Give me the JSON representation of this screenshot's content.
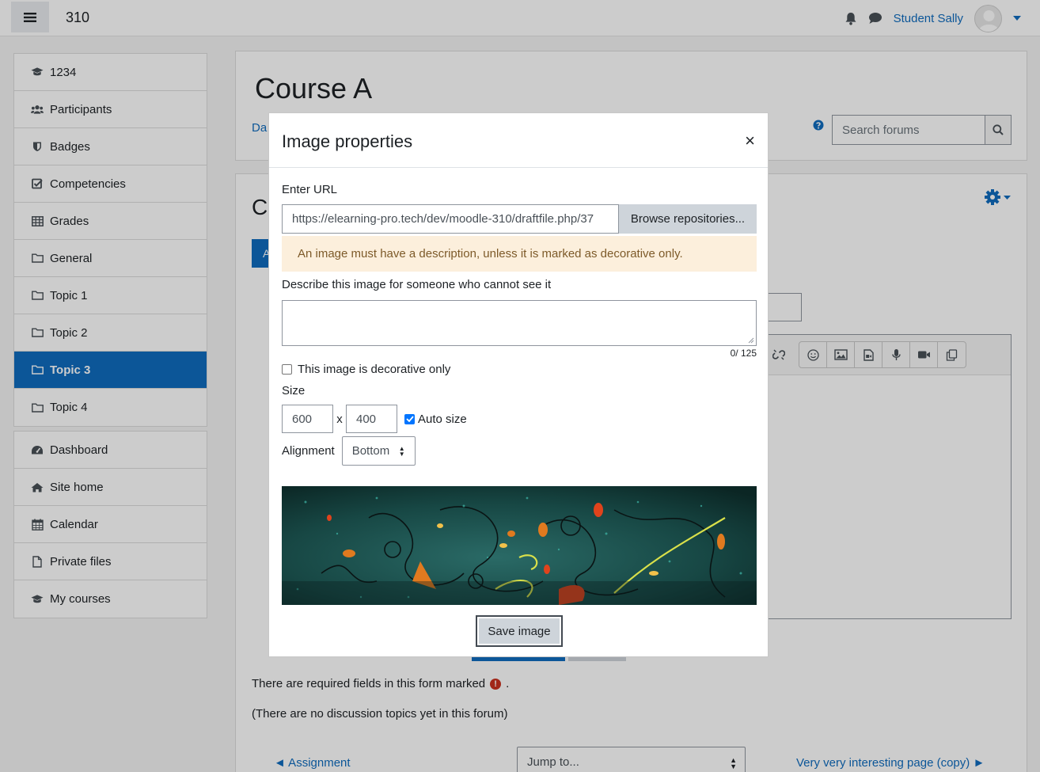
{
  "navbar": {
    "site_name": "310",
    "user_name": "Student Sally"
  },
  "sidebar": {
    "group1": [
      {
        "label": "1234",
        "icon": "graduation-cap-icon"
      },
      {
        "label": "Participants",
        "icon": "users-icon"
      },
      {
        "label": "Badges",
        "icon": "shield-icon"
      },
      {
        "label": "Competencies",
        "icon": "check-square-icon"
      },
      {
        "label": "Grades",
        "icon": "table-icon"
      },
      {
        "label": "General",
        "icon": "folder-icon"
      },
      {
        "label": "Topic 1",
        "icon": "folder-icon"
      },
      {
        "label": "Topic 2",
        "icon": "folder-icon"
      },
      {
        "label": "Topic 3",
        "icon": "folder-icon",
        "active": true
      },
      {
        "label": "Topic 4",
        "icon": "folder-icon"
      }
    ],
    "group2": [
      {
        "label": "Dashboard",
        "icon": "dashboard-icon"
      },
      {
        "label": "Site home",
        "icon": "home-icon"
      },
      {
        "label": "Calendar",
        "icon": "calendar-icon"
      },
      {
        "label": "Private files",
        "icon": "file-icon"
      },
      {
        "label": "My courses",
        "icon": "graduation-cap-icon"
      }
    ]
  },
  "main": {
    "course_title": "Course A",
    "breadcrumb_partial": "Da",
    "section_title_partial": "C",
    "button_partial": "A",
    "search_placeholder": "Search forums",
    "required_note": "There are required fields in this form marked",
    "required_suffix": ".",
    "no_topics": "(There are no discussion topics yet in this forum)",
    "prev_link": "◄ Assignment",
    "jump_to": "Jump to...",
    "next_link": "Very very interesting page (copy) ►"
  },
  "modal": {
    "title": "Image properties",
    "close": "×",
    "url_label": "Enter URL",
    "url_value": "https://elearning-pro.tech/dev/moodle-310/draftfile.php/37",
    "browse_label": "Browse repositories...",
    "warning": "An image must have a description, unless it is marked as decorative only.",
    "describe_label": "Describe this image for someone who cannot see it",
    "describe_value": "",
    "counter": "0/ 125",
    "decorative_label": "This image is decorative only",
    "decorative_checked": false,
    "size_label": "Size",
    "width": "600",
    "size_separator": "x",
    "height": "400",
    "auto_size_label": "Auto size",
    "auto_size_checked": true,
    "alignment_label": "Alignment",
    "alignment_value": "Bottom",
    "save_label": "Save image"
  },
  "colors": {
    "brand": "#0f6cbf",
    "warning_bg": "#fcefdc",
    "warning_text": "#7d5a29"
  }
}
